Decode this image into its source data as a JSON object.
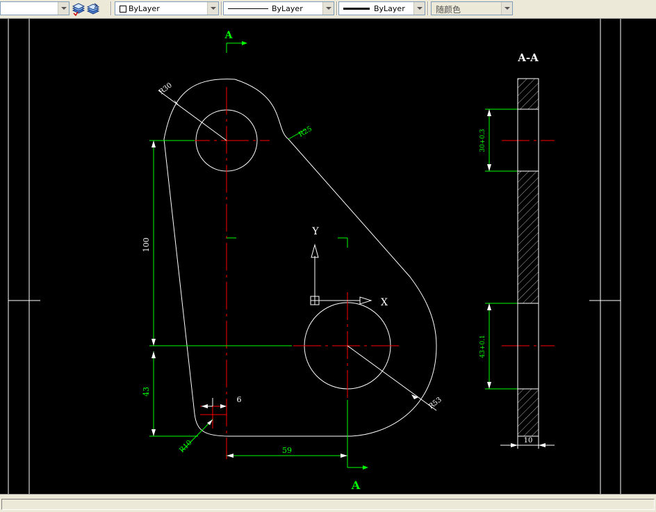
{
  "toolbar": {
    "layer_select": {
      "value": ""
    },
    "color_select": {
      "value": "ByLayer"
    },
    "linetype_select": {
      "value": "ByLayer"
    },
    "lineweight_select": {
      "value": "ByLayer"
    },
    "plotstyle_select": {
      "value": "随颜色"
    }
  },
  "drawing": {
    "section_marker_top": "A",
    "section_marker_bottom": "A",
    "section_view_title": "A-A",
    "dimensions": {
      "radius_top": "R30",
      "radius_fillet_top": "R25",
      "radius_bottom": "R53",
      "radius_fillet_bottom": "R10",
      "vertical_100": "100",
      "vertical_43": "43",
      "horizontal_59": "59",
      "horizontal_6": "6",
      "hole_top": "30+0.3",
      "hole_bottom": "43+0.1",
      "thickness": "10"
    },
    "ucs": {
      "x_label": "X",
      "y_label": "Y"
    }
  },
  "colors": {
    "outline": "#ffffff",
    "center_line": "#ff0000",
    "dimension": "#00ff00",
    "background": "#000000"
  }
}
